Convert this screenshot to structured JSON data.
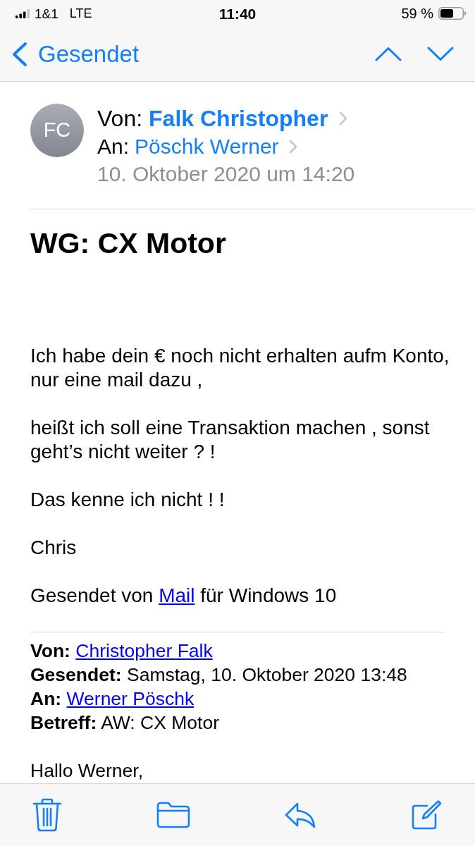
{
  "status_bar": {
    "carrier": "1&1",
    "network": "LTE",
    "time": "11:40",
    "battery": "59 %"
  },
  "nav_bar": {
    "back_label": "Gesendet"
  },
  "header": {
    "avatar_initials": "FC",
    "from_label": "Von:",
    "from_name": "Falk Christopher",
    "to_label": "An:",
    "to_name": "Pöschk Werner",
    "date": "10. Oktober 2020 um 14:20"
  },
  "message": {
    "subject": "WG: CX Motor",
    "body": [
      {
        "kind": "text",
        "text": "Ich habe dein € noch nicht erhalten aufm Konto, nur eine mail dazu ,"
      },
      {
        "kind": "text",
        "text": "heißt ich soll eine Transaktion machen , sonst geht’s nicht weiter ? !"
      },
      {
        "kind": "text",
        "text": "Das kenne ich nicht ! !"
      },
      {
        "kind": "text",
        "text": "Chris"
      },
      {
        "kind": "signature",
        "before": "Gesendet von",
        "link": "Mail",
        "after": "für Windows 10"
      }
    ],
    "quoted_header": [
      {
        "label": "Von:",
        "value": "Christopher Falk",
        "kind": "link"
      },
      {
        "label": "Gesendet:",
        "value": "Samstag, 10. Oktober 2020 13:48",
        "kind": "text"
      },
      {
        "label": "An:",
        "value": "Werner Pöschk",
        "kind": "link"
      },
      {
        "label": "Betreff:",
        "value": "AW: CX Motor",
        "kind": "text"
      }
    ],
    "quoted_body": [
      "Hallo Werner,"
    ]
  }
}
